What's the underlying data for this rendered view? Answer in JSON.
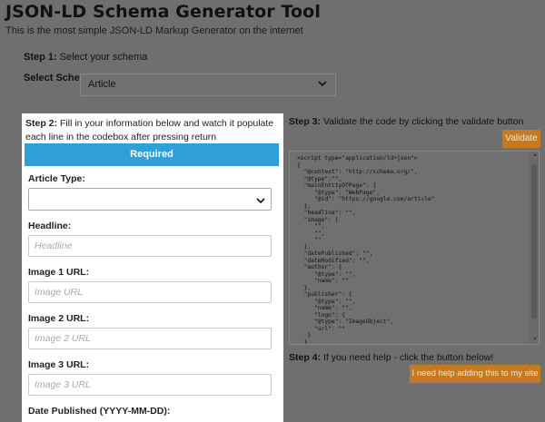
{
  "header": {
    "title": "JSON-LD Schema Generator Tool",
    "subtitle": "This is the most simple JSON-LD Markup Generator on the internet"
  },
  "step1": {
    "label": "Step 1:",
    "text": "Select your schema"
  },
  "schema_select": {
    "label": "Select Schema:",
    "value": "Article"
  },
  "step2": {
    "label": "Step 2:",
    "text": "Fill in your information below and watch it populate each line in the codebox after pressing return"
  },
  "required_label": "Required",
  "form": {
    "article_type_label": "Article Type:",
    "article_type_value": "",
    "headline_label": "Headline:",
    "headline_placeholder": "Headline",
    "image1_label": "Image 1 URL:",
    "image1_placeholder": "Image URL",
    "image2_label": "Image 2 URL:",
    "image2_placeholder": "Image 2 URL",
    "image3_label": "Image 3 URL:",
    "image3_placeholder": "Image 3 URL",
    "date_published_label": "Date Published (YYYY-MM-DD):"
  },
  "step3": {
    "label": "Step 3:",
    "text": "Validate the code by clicking the validate button"
  },
  "validate_label": "Validate",
  "code": "<script type=\"application/ld+json\">\n{\n  \"@context\": \"http://schema.org/\",\n  \"@type\":\"\",\n  \"mainEntityOfPage\": {\n     \"@type\": \"WebPage\",\n     \"@id\": \"https://google.com/article\"\n  },\n  \"headline\": \"\",\n  \"image\": [\n     \"\",\n     \"\",\n     \"\"\n  ],\n  \"datePublished\": \"\",\n  \"dateModified\": \"\",\n  \"author\": {\n     \"@type\": \"\",\n     \"name\": \"\"\n  },\n  \"publisher\": {\n     \"@type\": \"\",\n     \"name\": \"\",\n     \"logo\": {\n     \"@type\": \"ImageObject\",\n     \"url\": \"\"\n   }\n  }",
  "step4": {
    "label": "Step 4:",
    "text": "If you need help - click the button below!"
  },
  "help_label": "I need help adding this to my site",
  "colors": {
    "accent_blue": "#2e9fd8",
    "accent_orange": "#c47a22",
    "overlay": "#6f6f6f"
  },
  "icons": {
    "select_chevron": "chevron-down-icon"
  }
}
